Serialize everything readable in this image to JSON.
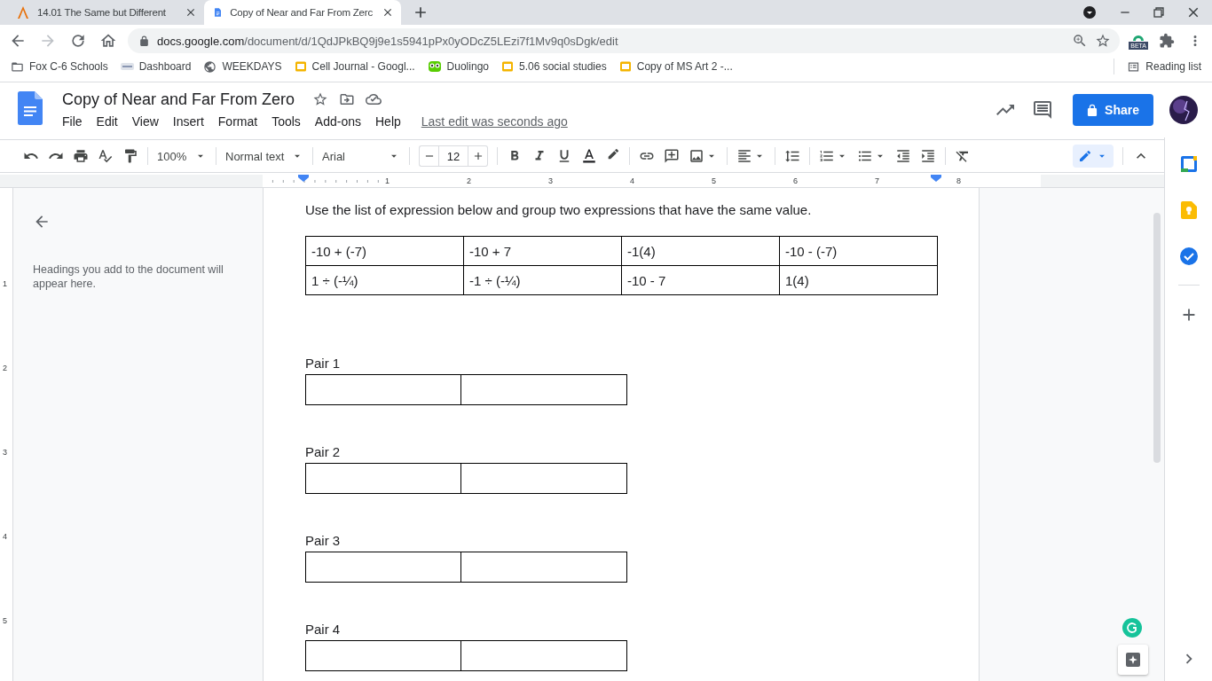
{
  "browser": {
    "tabs": [
      {
        "title": "14.01 The Same but Different",
        "kind": "lesson",
        "selected": false
      },
      {
        "title": "Copy of Near and Far From Zerc",
        "kind": "docs",
        "selected": true
      }
    ],
    "url": {
      "host": "docs.google.com",
      "path": "/document/d/1QdJPkBQ9j9e1s5941pPx0yODcZ5LEzi7f1Mv9q0sDgk/edit"
    },
    "extension_badge": "BETA",
    "bookmarks": [
      {
        "label": "Fox C-6 Schools",
        "kind": "folder-plain"
      },
      {
        "label": "Dashboard",
        "kind": "small"
      },
      {
        "label": "WEEKDAYS",
        "kind": "globe"
      },
      {
        "label": "Cell Journal - Googl...",
        "kind": "slides"
      },
      {
        "label": "Duolingo",
        "kind": "owl"
      },
      {
        "label": "5.06 social studies",
        "kind": "slides"
      },
      {
        "label": "Copy of MS Art 2 -...",
        "kind": "slides"
      }
    ],
    "reading_list": "Reading list"
  },
  "docs": {
    "title": "Copy of Near and Far From Zero",
    "menus": [
      "File",
      "Edit",
      "View",
      "Insert",
      "Format",
      "Tools",
      "Add-ons",
      "Help"
    ],
    "last_edit": "Last edit was seconds ago",
    "share": "Share",
    "toolbar": {
      "zoom": "100%",
      "style": "Normal text",
      "font": "Arial",
      "size": "12"
    },
    "ruler": [
      "1",
      "2",
      "3",
      "4",
      "5",
      "6",
      "7",
      "8"
    ],
    "vertical_ruler": [
      "1",
      "2",
      "3",
      "4",
      "5"
    ],
    "outline_hint": "Headings you add to the document will appear here."
  },
  "document": {
    "intro": "Use the list of expression below and group two expressions that have the same value.",
    "expressions": [
      [
        "-10 + (-7)",
        "-10 + 7",
        "-1(4)",
        "-10 - (-7)"
      ],
      [
        "1 ÷ (-¼)",
        "-1 ÷ (-¼)",
        "-10 - 7",
        "1(4)"
      ]
    ],
    "pairs": [
      {
        "label": "Pair 1"
      },
      {
        "label": "Pair 2"
      },
      {
        "label": "Pair 3"
      },
      {
        "label": "Pair 4"
      }
    ]
  }
}
